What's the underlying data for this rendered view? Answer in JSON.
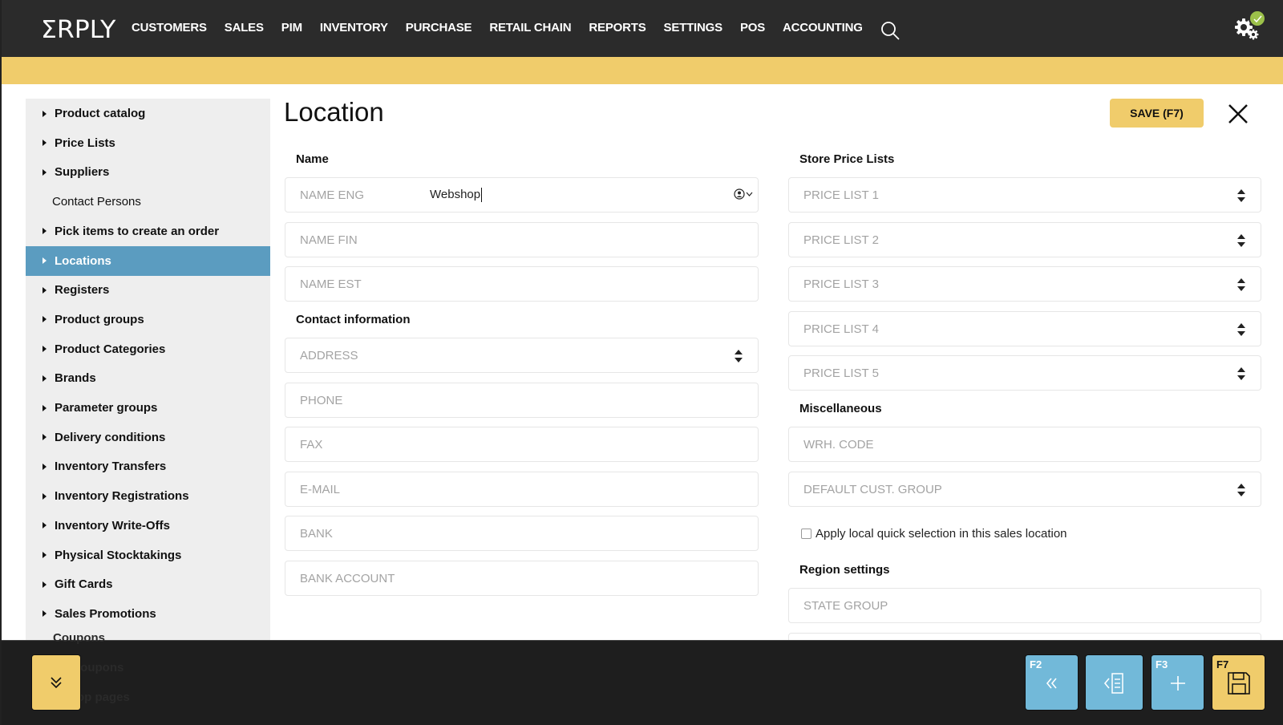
{
  "app": {
    "logo": "ΣRPLY",
    "nav": [
      "CUSTOMERS",
      "SALES",
      "PIM",
      "INVENTORY",
      "PURCHASE",
      "RETAIL CHAIN",
      "REPORTS",
      "SETTINGS",
      "POS",
      "ACCOUNTING"
    ],
    "status_ok": true
  },
  "sidebar": {
    "items": [
      {
        "label": "Product catalog",
        "type": "expandable",
        "active": false
      },
      {
        "label": "Price Lists",
        "type": "expandable",
        "active": false
      },
      {
        "label": "Suppliers",
        "type": "expandable",
        "active": false
      },
      {
        "label": "Contact Persons",
        "type": "plain",
        "active": false
      },
      {
        "label": "Pick items to create an order",
        "type": "expandable",
        "active": false
      },
      {
        "label": "Locations",
        "type": "expandable",
        "active": true
      },
      {
        "label": "Registers",
        "type": "expandable",
        "active": false
      },
      {
        "label": "Product groups",
        "type": "expandable",
        "active": false
      },
      {
        "label": "Product Categories",
        "type": "expandable",
        "active": false
      },
      {
        "label": "Brands",
        "type": "expandable",
        "active": false
      },
      {
        "label": "Parameter groups",
        "type": "expandable",
        "active": false
      },
      {
        "label": "Delivery conditions",
        "type": "expandable",
        "active": false
      },
      {
        "label": "Inventory Transfers",
        "type": "expandable",
        "active": false
      },
      {
        "label": "Inventory Registrations",
        "type": "expandable",
        "active": false
      },
      {
        "label": "Inventory Write-Offs",
        "type": "expandable",
        "active": false
      },
      {
        "label": "Physical Stocktakings",
        "type": "expandable",
        "active": false
      },
      {
        "label": "Gift Cards",
        "type": "expandable",
        "active": false
      },
      {
        "label": "Sales Promotions",
        "type": "expandable",
        "active": false
      }
    ],
    "hidden_items": [
      "Coupons",
      "...d coupons",
      "...shop pages"
    ]
  },
  "main": {
    "title": "Location",
    "save_label": "SAVE (F7)",
    "name_section": "Name",
    "name_fields": [
      {
        "placeholder": "NAME ENG",
        "value": "Webshop"
      },
      {
        "placeholder": "NAME FIN",
        "value": ""
      },
      {
        "placeholder": "NAME EST",
        "value": ""
      }
    ],
    "contact_section": "Contact information",
    "contact_fields": [
      {
        "placeholder": "ADDRESS",
        "type": "select"
      },
      {
        "placeholder": "PHONE",
        "type": "text"
      },
      {
        "placeholder": "FAX",
        "type": "text"
      },
      {
        "placeholder": "E-MAIL",
        "type": "text"
      },
      {
        "placeholder": "BANK",
        "type": "text"
      },
      {
        "placeholder": "BANK ACCOUNT",
        "type": "text"
      }
    ],
    "price_section": "Store Price Lists",
    "price_lists": [
      "PRICE LIST 1",
      "PRICE LIST 2",
      "PRICE LIST 3",
      "PRICE LIST 4",
      "PRICE LIST 5"
    ],
    "misc_section": "Miscellaneous",
    "misc_fields": [
      {
        "placeholder": "WRH. CODE",
        "type": "text"
      },
      {
        "placeholder": "DEFAULT CUST. GROUP",
        "type": "select"
      }
    ],
    "quick_selection_label": "Apply local quick selection in this sales location",
    "quick_selection_checked": false,
    "region_section": "Region settings",
    "region_fields": [
      {
        "placeholder": "STATE GROUP",
        "type": "text"
      }
    ]
  },
  "footer": {
    "buttons": [
      {
        "key": "F2",
        "icon": "double-chevron-left-icon"
      },
      {
        "key": "",
        "icon": "back-to-list-icon"
      },
      {
        "key": "F3",
        "icon": "plus-icon"
      },
      {
        "key": "F7",
        "icon": "floppy-disk-icon"
      }
    ]
  },
  "colors": {
    "accent_yellow": "#f0cc6b",
    "active_blue": "#5b9cc0",
    "footer_blue": "#72b9d9",
    "topbar": "#2b2b2b",
    "status_green": "#9cc14a"
  }
}
